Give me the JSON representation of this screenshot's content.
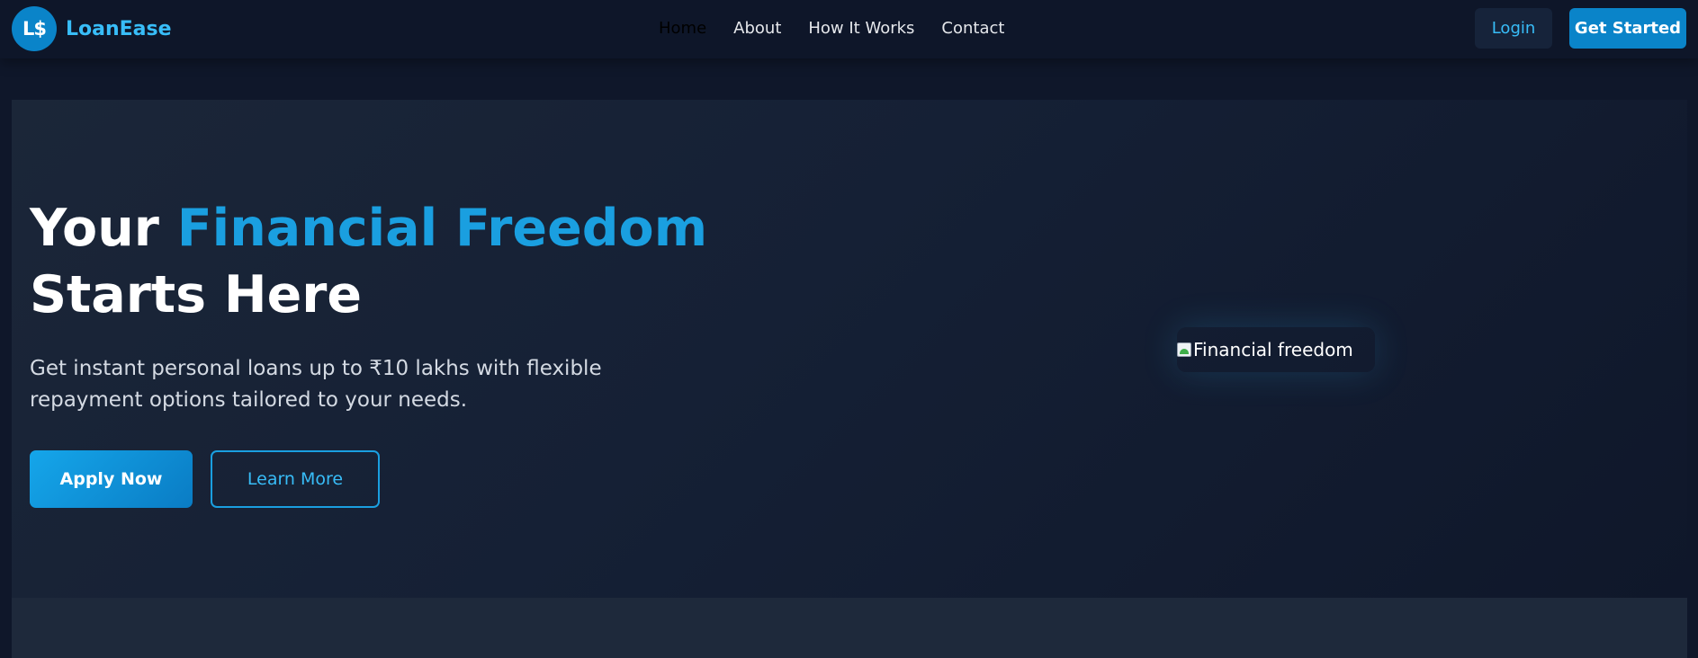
{
  "brand": {
    "logo_text": "L$",
    "name": "LoanEase"
  },
  "nav": {
    "links": [
      "Home",
      "About",
      "How It Works",
      "Contact"
    ]
  },
  "header_actions": {
    "login": "Login",
    "get_started": "Get Started"
  },
  "hero": {
    "title_part1": "Your ",
    "title_accent": "Financial Freedom",
    "title_part2": " Starts Here",
    "subtitle": "Get instant personal loans up to ₹10 lakhs with flexible repayment options tailored to your needs.",
    "apply_button": "Apply Now",
    "learn_button": "Learn More",
    "image_alt": "Financial freedom"
  },
  "colors": {
    "accent": "#1a9fe0",
    "brand_blue": "#0a84c9",
    "link_blue": "#38bdf8",
    "background": "#0f172a"
  },
  "icons": {
    "hero_image": "broken-image-icon"
  }
}
